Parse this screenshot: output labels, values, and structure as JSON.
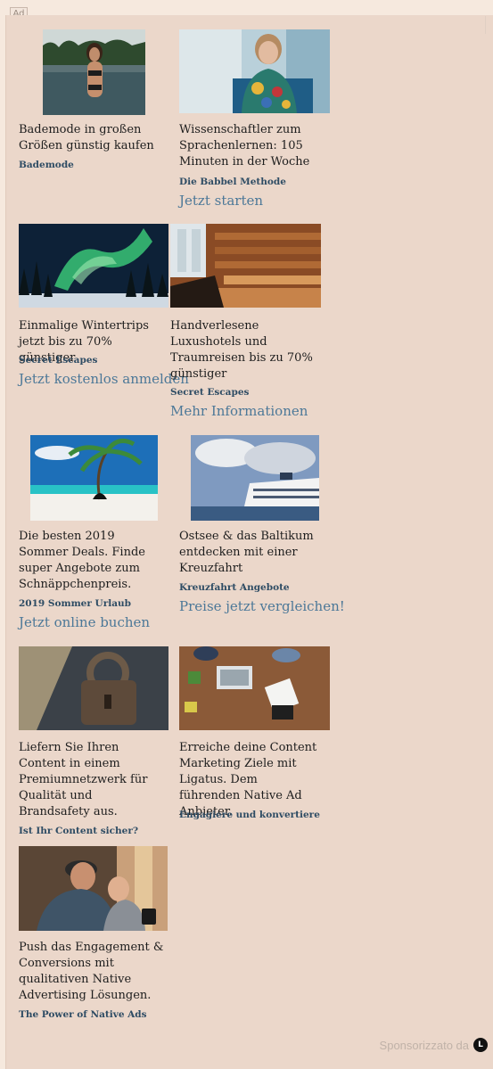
{
  "ad_label": "Ad",
  "cards": [
    {
      "title": "Bademode in großen Größen günstig kaufen",
      "brand": "Bademode",
      "cta": ""
    },
    {
      "title": "Wissenschaftler zum Sprachenlernen: 105 Minuten in der Woche",
      "brand": "Die Babbel Methode",
      "cta": "Jetzt starten"
    },
    {
      "title": "Einmalige Wintertrips jetzt bis zu 70% günstiger",
      "brand": "Secret Escapes",
      "cta": "Jetzt kostenlos anmelden"
    },
    {
      "title": "Handverlesene Luxushotels und Traumreisen bis zu 70% günstiger",
      "brand": "Secret Escapes",
      "cta": "Mehr Informationen"
    },
    {
      "title": "Die besten 2019 Sommer Deals. Finde super Angebote zum Schnäppchenpreis.",
      "brand": "2019 Sommer Urlaub",
      "cta": "Jetzt online buchen"
    },
    {
      "title": "Ostsee & das Baltikum entdecken mit einer Kreuzfahrt",
      "brand": "Kreuzfahrt Angebote",
      "cta": "Preise jetzt vergleichen!"
    },
    {
      "title": "Liefern Sie Ihren Content in einem Premiumnetzwerk für Qualität und Brandsafety aus.",
      "brand": "Ist Ihr Content sicher?",
      "cta": ""
    },
    {
      "title": "Erreiche deine Content Marketing Ziele mit Ligatus. Dem führenden Native Ad Anbieter.",
      "brand": "Engagiere und konvertiere",
      "cta": ""
    },
    {
      "title": "Push das Engagement & Conversions mit qualitativen Native Advertising Lösungen.",
      "brand": "The Power of Native Ads",
      "cta": ""
    }
  ],
  "footer": {
    "sponsor_text": "Sponsorizzato da",
    "logo_letter": "L"
  },
  "colors": {
    "background": "#ebd7ca",
    "brand_text": "#2e4c64",
    "cta_text": "#4c7898"
  }
}
